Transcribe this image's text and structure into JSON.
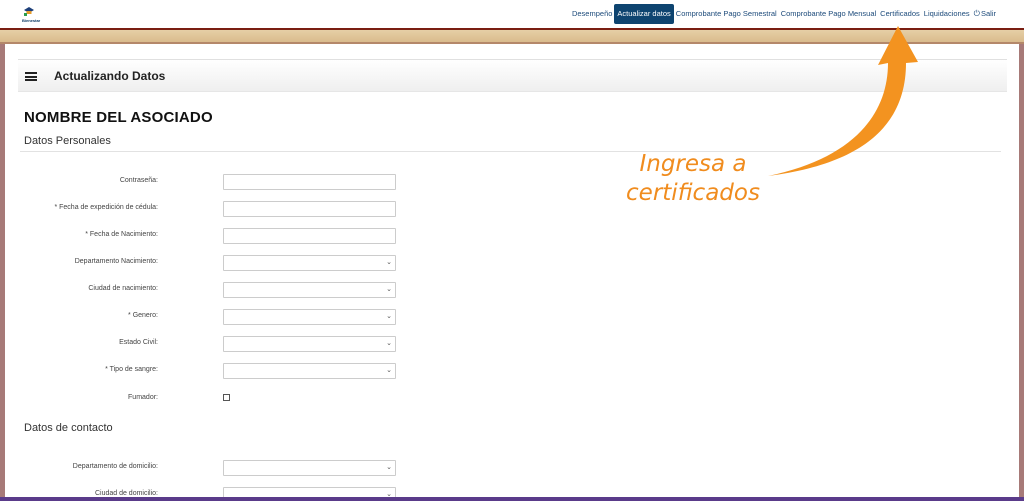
{
  "logo": {
    "text": "Bienestar"
  },
  "nav": {
    "items": [
      {
        "label": "Desempeño",
        "active": false
      },
      {
        "label": "Actualizar datos",
        "active": true
      },
      {
        "label": "Comprobante Pago Semestral",
        "active": false
      },
      {
        "label": "Comprobante Pago Mensual",
        "active": false
      },
      {
        "label": "Certificados",
        "active": false
      },
      {
        "label": "Liquidaciones",
        "active": false
      },
      {
        "label": "Salir",
        "active": false
      }
    ]
  },
  "header": {
    "title": "Actualizando Datos"
  },
  "associate_name": "NOMBRE DEL ASOCIADO",
  "sections": {
    "personal": "Datos Personales",
    "contact": "Datos de contacto"
  },
  "personal_fields": [
    {
      "label": "Contraseña:",
      "type": "input",
      "value": ""
    },
    {
      "label": "* Fecha de expedición de cédula:",
      "type": "input",
      "value": ""
    },
    {
      "label": "* Fecha de Nacimiento:",
      "type": "input",
      "value": ""
    },
    {
      "label": "Departamento Nacimiento:",
      "type": "select",
      "value": ""
    },
    {
      "label": "Ciudad de nacimiento:",
      "type": "select",
      "value": ""
    },
    {
      "label": "* Genero:",
      "type": "select",
      "value": ""
    },
    {
      "label": "Estado Civil:",
      "type": "select",
      "value": ""
    },
    {
      "label": "* Tipo de sangre:",
      "type": "select",
      "value": ""
    },
    {
      "label": "Fumador:",
      "type": "checkbox",
      "checked": false
    }
  ],
  "contact_fields": [
    {
      "label": "Departamento de domicilio:",
      "type": "select",
      "value": ""
    },
    {
      "label": "Ciudad de domicilio:",
      "type": "select",
      "value": ""
    }
  ],
  "annotation": {
    "line1": "Ingresa a",
    "line2": "certificados",
    "color": "#f08c1e"
  },
  "colors": {
    "nav_active": "#0e4470",
    "nav_text": "#1c4a7a",
    "band": "#d8b888",
    "band_top": "#7a1e12"
  }
}
